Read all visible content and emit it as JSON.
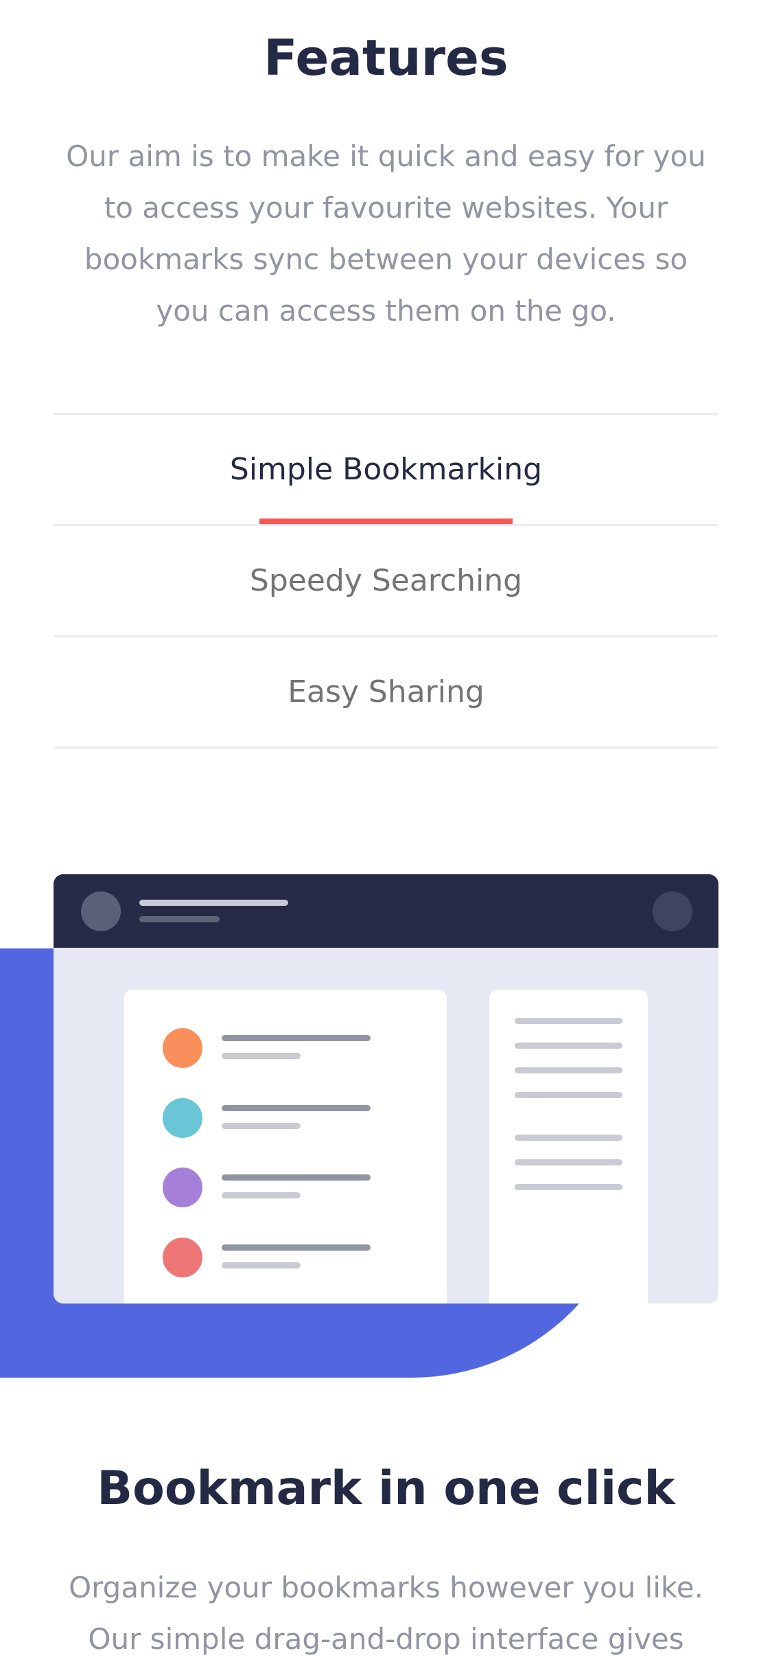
{
  "features": {
    "title": "Features",
    "description": "Our aim is to make it quick and easy for you to access your favourite websites. Your bookmarks sync between your devices so you can access them on the go."
  },
  "tabs": [
    {
      "label": "Simple Bookmarking",
      "active": true
    },
    {
      "label": "Speedy Searching",
      "active": false
    },
    {
      "label": "Easy Sharing",
      "active": false
    }
  ],
  "illustration": {
    "bookmark_dot_colors": [
      "#f98f5b",
      "#6ac6d6",
      "#a67fd8",
      "#ef7676"
    ],
    "accent_blue": "#5267df",
    "tab_indicator_color": "#fa5757"
  },
  "click_section": {
    "title": "Bookmark in one click",
    "description": "Organize your bookmarks however you like. Our simple drag-and-drop interface gives"
  }
}
